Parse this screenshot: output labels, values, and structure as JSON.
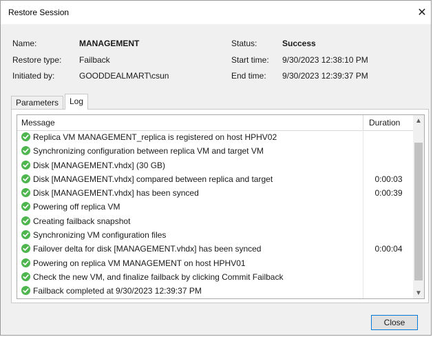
{
  "window": {
    "title": "Restore Session",
    "close_glyph": "✕"
  },
  "info": {
    "name_label": "Name:",
    "name_value": "MANAGEMENT",
    "restore_type_label": "Restore type:",
    "restore_type_value": "Failback",
    "initiated_by_label": "Initiated by:",
    "initiated_by_value": "GOODDEALMART\\csun",
    "status_label": "Status:",
    "status_value": "Success",
    "start_time_label": "Start time:",
    "start_time_value": "9/30/2023 12:38:10 PM",
    "end_time_label": "End time:",
    "end_time_value": "9/30/2023 12:39:37 PM"
  },
  "tabs": [
    {
      "label": "Parameters",
      "active": false
    },
    {
      "label": "Log",
      "active": true
    }
  ],
  "log": {
    "columns": {
      "message": "Message",
      "duration": "Duration"
    },
    "rows": [
      {
        "status": "success",
        "message": "Replica VM MANAGEMENT_replica is registered on host HPHV02",
        "duration": ""
      },
      {
        "status": "success",
        "message": "Synchronizing configuration between replica VM and target VM",
        "duration": ""
      },
      {
        "status": "success",
        "message": "Disk [MANAGEMENT.vhdx] (30 GB)",
        "duration": ""
      },
      {
        "status": "success",
        "message": "Disk [MANAGEMENT.vhdx] compared between replica and target",
        "duration": "0:00:03"
      },
      {
        "status": "success",
        "message": "Disk [MANAGEMENT.vhdx] has been synced",
        "duration": "0:00:39"
      },
      {
        "status": "success",
        "message": "Powering off replica VM",
        "duration": ""
      },
      {
        "status": "success",
        "message": "Creating failback snapshot",
        "duration": ""
      },
      {
        "status": "success",
        "message": "Synchronizing VM configuration files",
        "duration": ""
      },
      {
        "status": "success",
        "message": "Failover delta for disk [MANAGEMENT.vhdx] has been synced",
        "duration": "0:00:04"
      },
      {
        "status": "success",
        "message": "Powering on replica VM MANAGEMENT on host HPHV01",
        "duration": ""
      },
      {
        "status": "success",
        "message": "Check the new VM, and finalize failback by clicking Commit Failback",
        "duration": ""
      },
      {
        "status": "success",
        "message": "Failback completed at 9/30/2023 12:39:37 PM",
        "duration": ""
      }
    ]
  },
  "buttons": {
    "close_label": "Close"
  },
  "colors": {
    "success_icon": "#4fb64f",
    "focus_border": "#0078d7"
  }
}
